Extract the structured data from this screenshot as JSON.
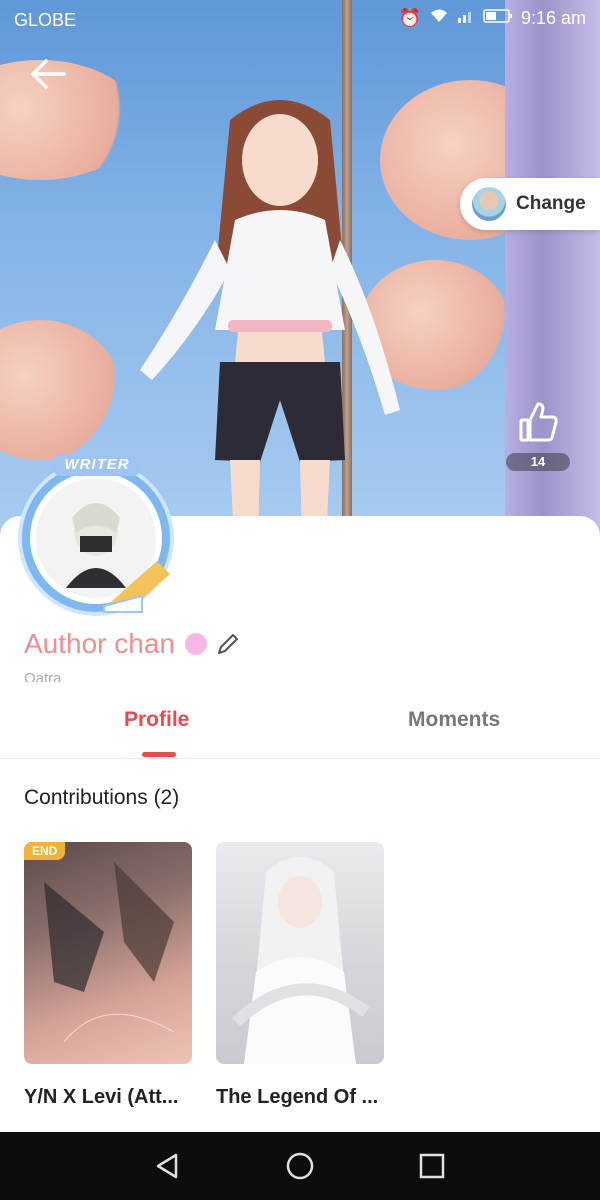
{
  "status_bar": {
    "carrier": "GLOBE",
    "time": "9:16 am"
  },
  "header": {
    "back_icon": "arrow-left-icon",
    "change_label": "Change"
  },
  "likes": {
    "count": "14"
  },
  "profile": {
    "badge": "WRITER",
    "name": "Author chan",
    "subtitle": "Oatra"
  },
  "tabs": [
    {
      "label": "Profile",
      "active": true
    },
    {
      "label": "Moments",
      "active": false
    }
  ],
  "contributions": {
    "heading": "Contributions (2)",
    "books": [
      {
        "tag": "END",
        "title": "Y/N X Levi (Att..."
      },
      {
        "tag": "",
        "title": "The Legend Of ..."
      }
    ]
  },
  "colors": {
    "accent": "#e94b4b",
    "name": "#ec8f8f",
    "end_tag": "#f0b23a"
  }
}
